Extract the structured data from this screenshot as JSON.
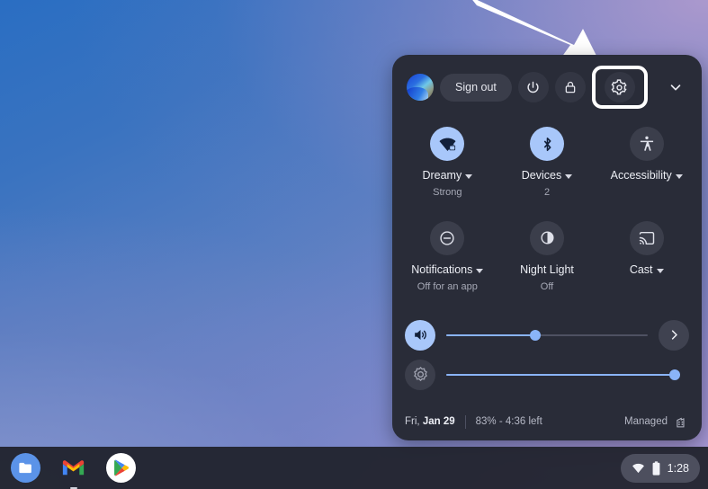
{
  "wallpaper": {
    "colors": [
      "#2a6ec2",
      "#5b7fc2",
      "#ab9bd6"
    ]
  },
  "annotation": {
    "type": "arrow",
    "points_to": "settings-button",
    "color": "#ffffff"
  },
  "panel": {
    "header": {
      "avatar": "user-avatar",
      "sign_out_label": "Sign out",
      "power_icon": "power-icon",
      "lock_icon": "lock-icon",
      "settings_icon": "gear-icon",
      "collapse_icon": "chevron-down-icon",
      "highlighted": "settings-button"
    },
    "tiles": [
      {
        "name": "network",
        "icon": "wifi-locked-icon",
        "label": "Dreamy",
        "sub": "Strong",
        "state": "on",
        "caret": true
      },
      {
        "name": "bluetooth",
        "icon": "bluetooth-icon",
        "label": "Devices",
        "sub": "2",
        "state": "on",
        "caret": true
      },
      {
        "name": "accessibility",
        "icon": "accessibility-icon",
        "label": "Accessibility",
        "sub": "",
        "state": "off",
        "caret": true
      },
      {
        "name": "notifications",
        "icon": "do-not-disturb-icon",
        "label": "Notifications",
        "sub": "Off for an app",
        "state": "off",
        "caret": true
      },
      {
        "name": "night-light",
        "icon": "half-moon-icon",
        "label": "Night Light",
        "sub": "Off",
        "state": "off",
        "caret": false
      },
      {
        "name": "cast",
        "icon": "cast-icon",
        "label": "Cast",
        "sub": "",
        "state": "off",
        "caret": true
      }
    ],
    "sliders": [
      {
        "name": "volume",
        "icon": "volume-icon",
        "value": 44,
        "state": "on"
      },
      {
        "name": "brightness",
        "icon": "brightness-icon",
        "value": 100,
        "state": "off"
      }
    ],
    "next_icon": "chevron-right-icon",
    "footer": {
      "date_prefix": "Fri, ",
      "date_bold": "Jan 29",
      "battery": "83% - 4:36 left",
      "managed_label": "Managed",
      "managed_icon": "enterprise-icon"
    }
  },
  "shelf": {
    "apps": [
      {
        "name": "files",
        "icon": "folder-icon"
      },
      {
        "name": "gmail",
        "icon": "gmail-icon"
      },
      {
        "name": "play-store",
        "icon": "play-store-icon"
      }
    ],
    "tray": {
      "wifi_icon": "wifi-icon",
      "battery_icon": "battery-icon",
      "time": "1:28"
    }
  }
}
